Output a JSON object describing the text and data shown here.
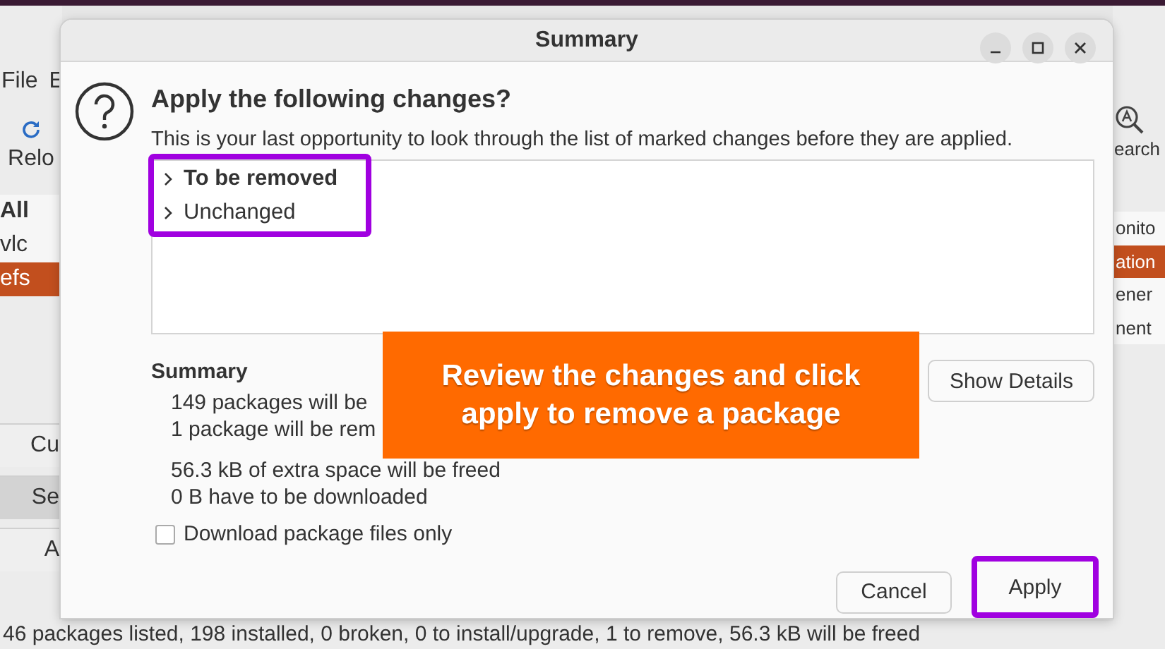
{
  "background_app": {
    "menu": [
      "File",
      "E"
    ],
    "toolbar": [
      {
        "label": "Relo"
      }
    ],
    "search_label": "earch",
    "left_list": [
      {
        "label": "All",
        "kind": "header",
        "selected": false
      },
      {
        "label": "vlc",
        "kind": "item",
        "selected": false
      },
      {
        "label": "efs",
        "kind": "item",
        "selected": true
      }
    ],
    "left_buttons": [
      {
        "label": "Cu",
        "selected": false
      },
      {
        "label": "Se",
        "selected": true
      },
      {
        "label": "A",
        "selected": false
      }
    ],
    "right_list": [
      {
        "label": "onito",
        "selected": false
      },
      {
        "label": "ation",
        "selected": true
      },
      {
        "label": "ener",
        "selected": false
      },
      {
        "label": "nent",
        "selected": false
      }
    ],
    "status_bar": "46 packages listed, 198 installed, 0 broken, 0 to install/upgrade, 1 to remove, 56.3 kB will be freed"
  },
  "dialog": {
    "title": "Summary",
    "heading": "Apply the following changes?",
    "description": "This is your last opportunity to look through the list of marked changes before they are applied.",
    "tree": {
      "highlighted": true,
      "items": [
        {
          "label": "To be removed",
          "emphasized": true,
          "expanded": false
        },
        {
          "label": "Unchanged",
          "emphasized": false,
          "expanded": false
        }
      ]
    },
    "summary_title": "Summary",
    "summary_groups": [
      [
        "149 packages will be",
        "1 package will be rem"
      ],
      [
        "56.3 kB of extra space will be freed",
        "0  B have to be downloaded"
      ]
    ],
    "show_details": "Show Details",
    "checkbox": {
      "label": "Download package files only",
      "checked": false
    },
    "buttons": [
      {
        "label": "Cancel",
        "highlighted": false
      },
      {
        "label": "Apply",
        "highlighted": true
      }
    ]
  },
  "callout": "Review the changes and click apply to remove a package"
}
